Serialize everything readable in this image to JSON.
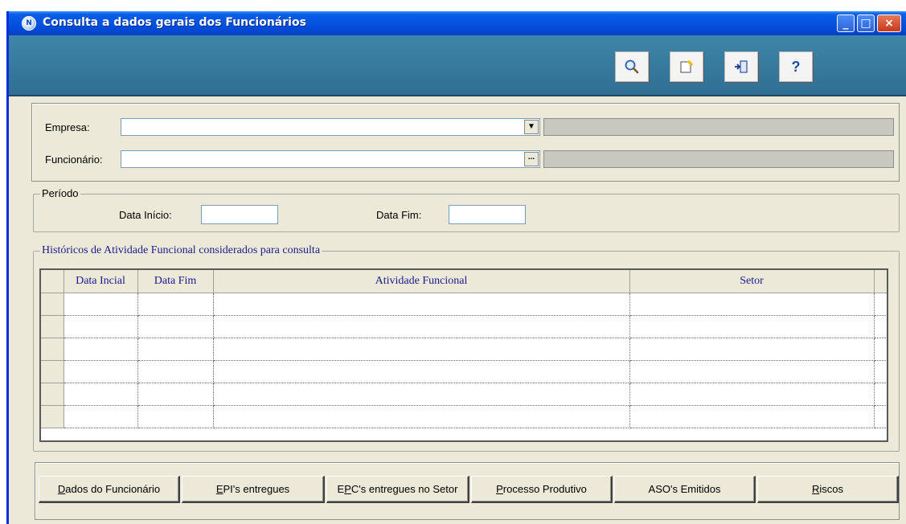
{
  "window": {
    "title": "Consulta a dados gerais dos Funcionários",
    "app_icon_glyph": "N",
    "controls": {
      "minimize": "_",
      "maximize": "□",
      "close": "×"
    }
  },
  "toolbar": {
    "buttons": [
      {
        "name": "search",
        "icon": "magnifier-icon"
      },
      {
        "name": "edit",
        "icon": "note-edit-icon"
      },
      {
        "name": "exit",
        "icon": "door-exit-icon"
      },
      {
        "name": "help",
        "icon": "question-icon",
        "glyph": "?"
      }
    ]
  },
  "form": {
    "empresa_label": "Empresa:",
    "empresa_value": "",
    "funcionario_label": "Funcionário:",
    "funcionario_value": "",
    "ellipsis": "...",
    "dropdown_glyph": "▼"
  },
  "periodo": {
    "title": "Período",
    "data_inicio_label": "Data Início:",
    "data_inicio_value": "",
    "data_fim_label": "Data Fim:",
    "data_fim_value": ""
  },
  "historico": {
    "title": "Históricos de Atividade Funcional considerados para consulta",
    "columns": [
      "Data Incial",
      "Data Fim",
      "Atividade Funcional",
      "Setor"
    ],
    "rows": [
      [
        "",
        "",
        "",
        ""
      ],
      [
        "",
        "",
        "",
        ""
      ],
      [
        "",
        "",
        "",
        ""
      ],
      [
        "",
        "",
        "",
        ""
      ],
      [
        "",
        "",
        "",
        ""
      ],
      [
        "",
        "",
        "",
        ""
      ]
    ]
  },
  "bottom_buttons": [
    {
      "mnemonic": "D",
      "rest": "ados do Funcionário"
    },
    {
      "mnemonic": "E",
      "rest": "PI's entregues"
    },
    {
      "pre": "E",
      "mnemonic": "P",
      "rest": "C's entregues no Setor"
    },
    {
      "mnemonic": "P",
      "rest": "rocesso Produtivo"
    },
    {
      "mnemonic": "",
      "rest": "ASO's Emitidos"
    },
    {
      "mnemonic": "R",
      "rest": "iscos"
    }
  ],
  "colors": {
    "titlebar": "#0453e0",
    "toolbar": "#3f86a8",
    "window_bg": "#ece9d8",
    "grid_text": "#1a1a8c"
  }
}
